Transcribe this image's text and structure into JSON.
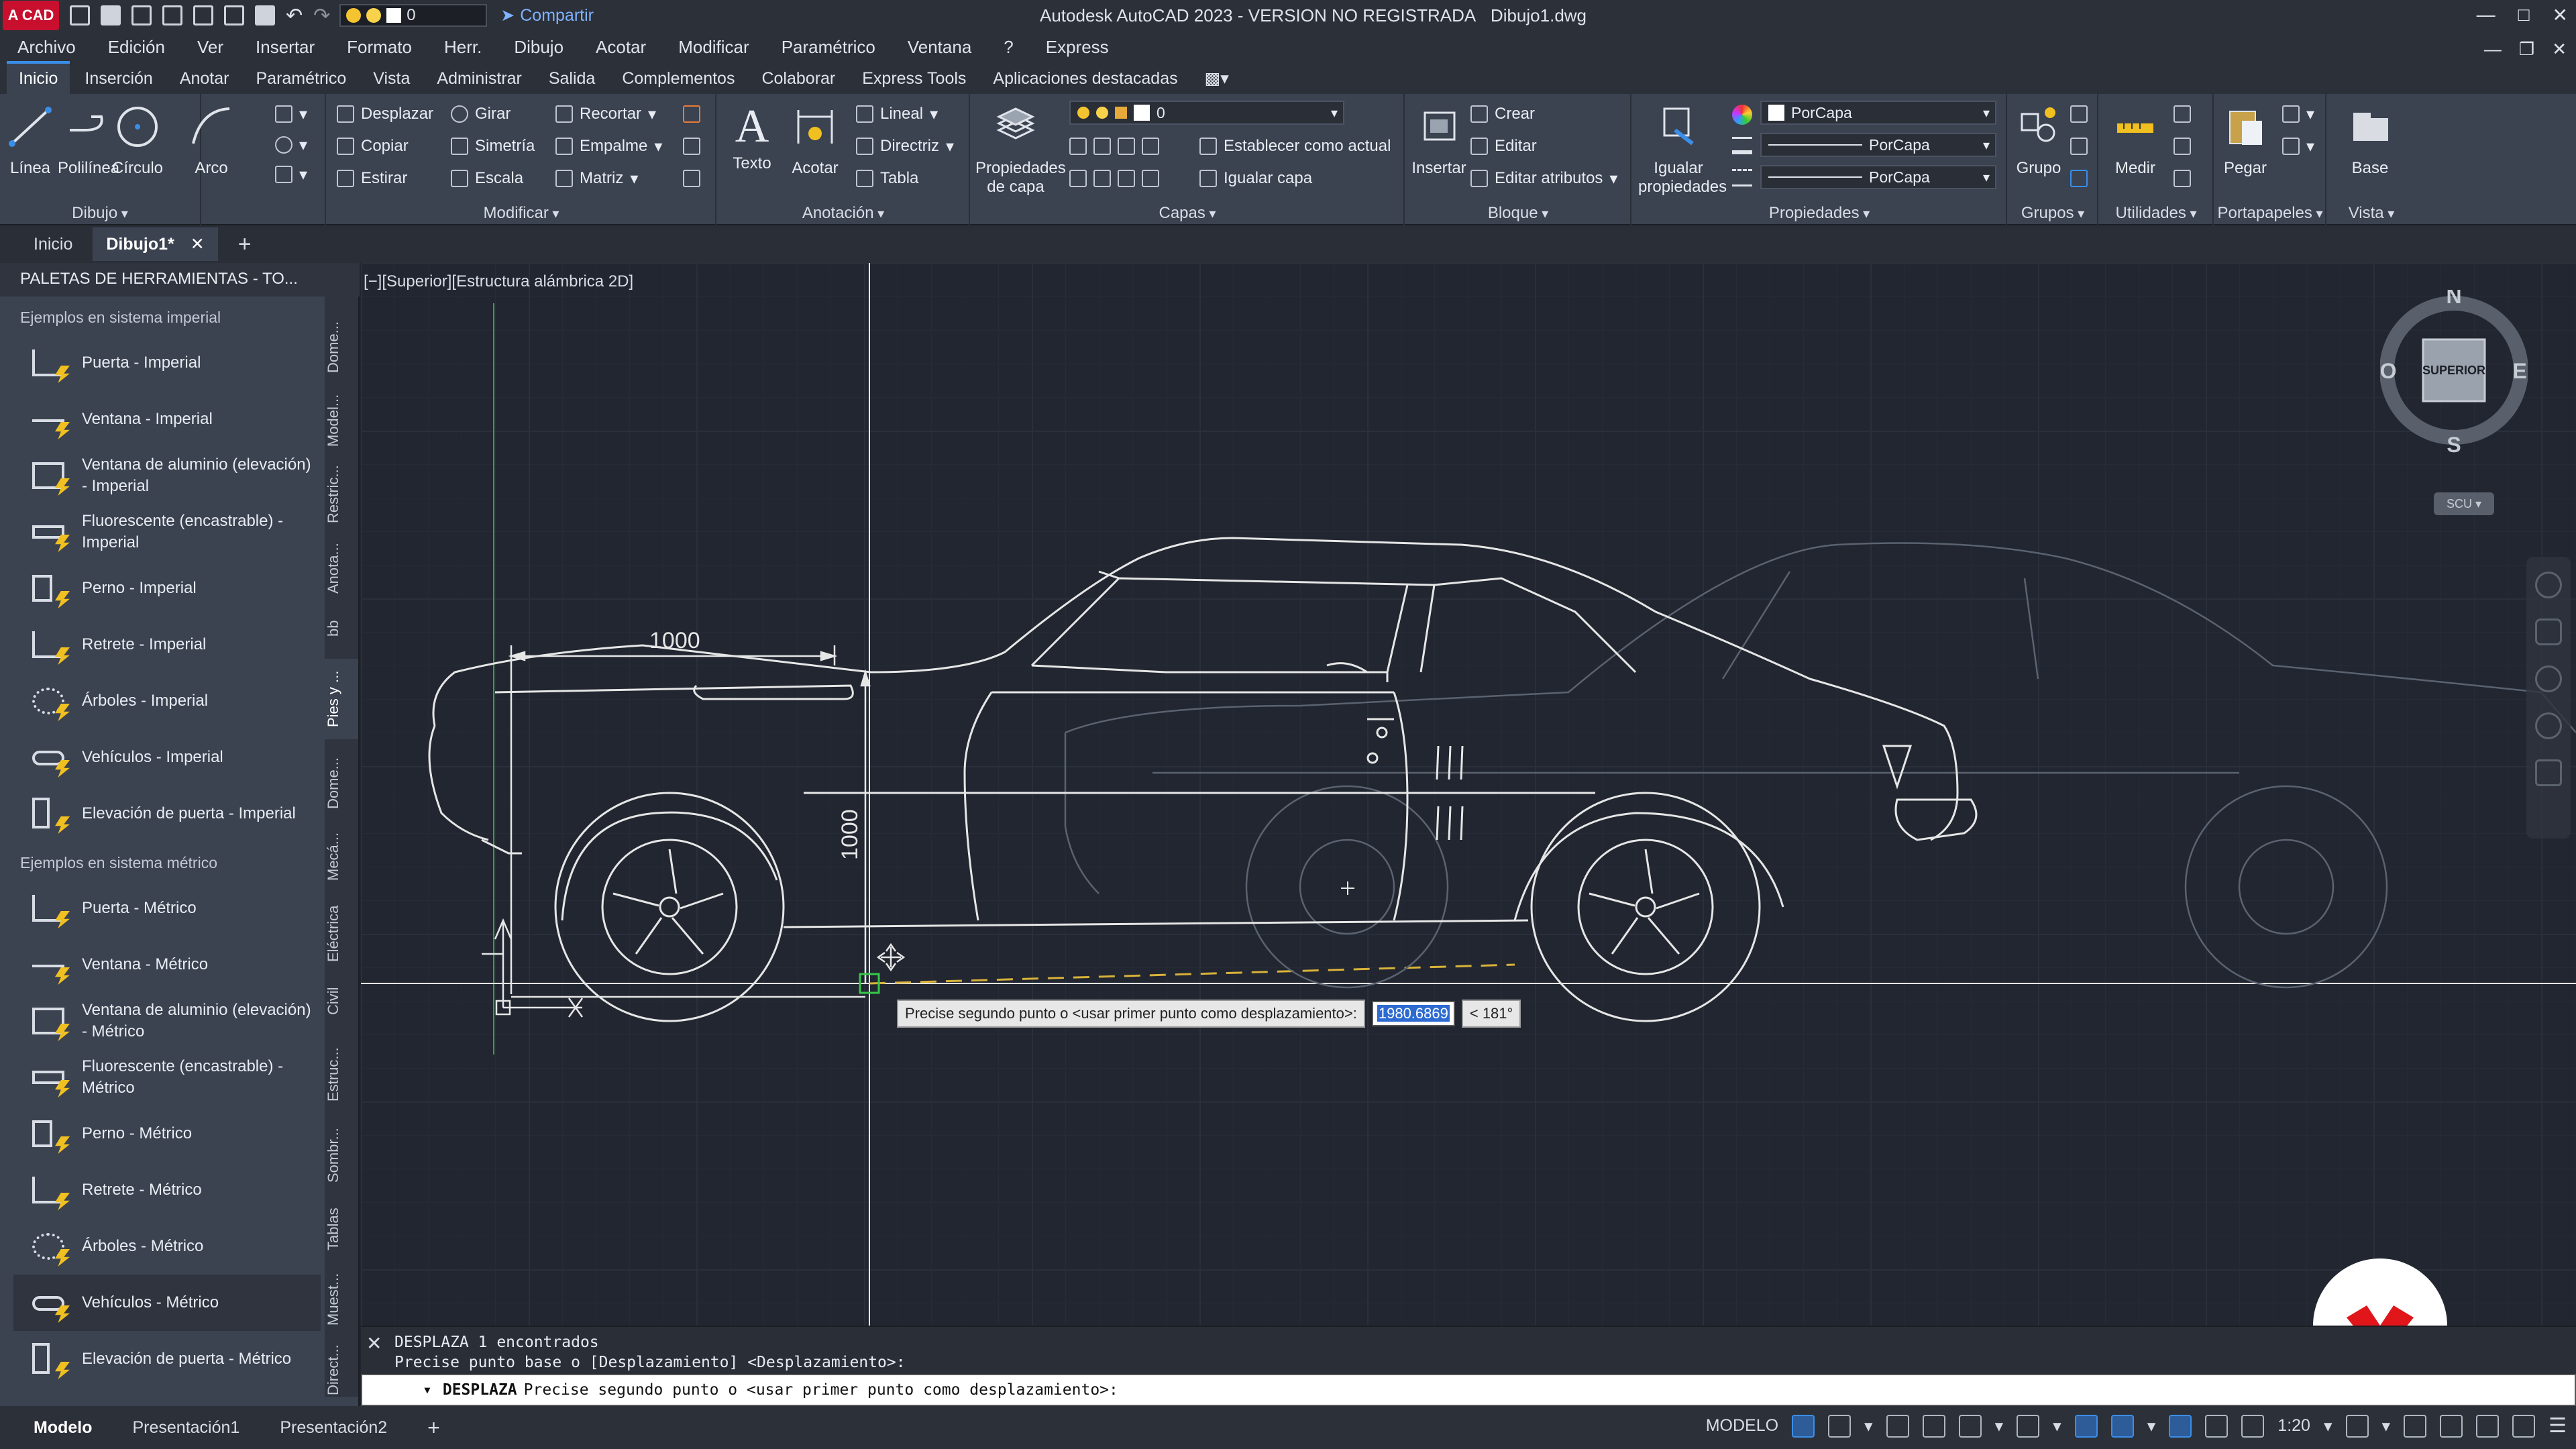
{
  "titlebar": {
    "app_logo": "A CAD",
    "layer_value": "0",
    "share_label": "Compartir",
    "title": "Autodesk AutoCAD 2023 - VERSION NO REGISTRADA",
    "filename": "Dibujo1.dwg"
  },
  "menu": [
    "Archivo",
    "Edición",
    "Ver",
    "Insertar",
    "Formato",
    "Herr.",
    "Dibujo",
    "Acotar",
    "Modificar",
    "Paramétrico",
    "Ventana",
    "?",
    "Express"
  ],
  "ribbon_tabs": [
    "Inicio",
    "Inserción",
    "Anotar",
    "Paramétrico",
    "Vista",
    "Administrar",
    "Salida",
    "Complementos",
    "Colaborar",
    "Express Tools",
    "Aplicaciones destacadas"
  ],
  "ribbon": {
    "dibujo": {
      "title": "Dibujo",
      "linea": "Línea",
      "polilinea": "Polilínea",
      "circulo": "Círculo",
      "arco": "Arco"
    },
    "modificar": {
      "title": "Modificar",
      "desplazar": "Desplazar",
      "girar": "Girar",
      "recortar": "Recortar",
      "copiar": "Copiar",
      "simetria": "Simetría",
      "empalme": "Empalme",
      "estirar": "Estirar",
      "escala": "Escala",
      "matriz": "Matriz"
    },
    "anotacion": {
      "title": "Anotación",
      "texto": "Texto",
      "acotar": "Acotar",
      "lineal": "Lineal",
      "directriz": "Directriz",
      "tabla": "Tabla"
    },
    "capas": {
      "title": "Capas",
      "propiedades": "Propiedades de capa",
      "layer": "0",
      "establecer": "Establecer como actual",
      "igualar": "Igualar capa"
    },
    "bloque": {
      "title": "Bloque",
      "insertar": "Insertar",
      "crear": "Crear",
      "editar": "Editar",
      "editar_atributos": "Editar atributos"
    },
    "propiedades": {
      "title": "Propiedades",
      "igualar": "Igualar propiedades",
      "color": "PorCapa",
      "linetype": "PorCapa",
      "lineweight": "PorCapa"
    },
    "grupos": {
      "title": "Grupos",
      "grupo": "Grupo"
    },
    "utilidades": {
      "title": "Utilidades",
      "medir": "Medir"
    },
    "portapapeles": {
      "title": "Portapapeles",
      "pegar": "Pegar"
    },
    "vista": {
      "title": "Vista",
      "base": "Base"
    }
  },
  "doc_tabs": {
    "inicio": "Inicio",
    "dibujo": "Dibujo1*"
  },
  "palette": {
    "header": "PALETAS DE HERRAMIENTAS - TO...",
    "group_imperial": "Ejemplos en sistema imperial",
    "imperial_items": [
      "Puerta - Imperial",
      "Ventana - Imperial",
      "Ventana de aluminio (elevación) - Imperial",
      "Fluorescente (encastrable) - Imperial",
      "Perno - Imperial",
      "Retrete - Imperial",
      "Árboles - Imperial",
      "Vehículos - Imperial",
      "Elevación de puerta - Imperial"
    ],
    "group_metric": "Ejemplos en sistema métrico",
    "metric_items": [
      "Puerta - Métrico",
      "Ventana - Métrico",
      "Ventana de aluminio (elevación) - Métrico",
      "Fluorescente (encastrable) - Métrico",
      "Perno - Métrico",
      "Retrete - Métrico",
      "Árboles - Métrico",
      "Vehículos - Métrico",
      "Elevación de puerta - Métrico"
    ],
    "side_tabs": [
      "Dome...",
      "Model...",
      "Restric...",
      "Anota...",
      "bb",
      "Pies y ...",
      "Dome...",
      "Mecá...",
      "Eléctrica",
      "Civil",
      "Estruc...",
      "Sombr...",
      "Tablas",
      "Muest...",
      "Direct..."
    ]
  },
  "viewport": {
    "label": "[−][Superior][Estructura alámbrica 2D]",
    "dim_horizontal": "1000",
    "dim_vertical": "1000",
    "viewcube": {
      "n": "N",
      "s": "S",
      "e": "E",
      "w": "O",
      "face": "SUPERIOR",
      "ucs": "SCU"
    }
  },
  "dynamic_input": {
    "prompt": "Precise segundo punto o <usar primer punto como desplazamiento>:",
    "value": "1980.6869",
    "angle": "< 181°"
  },
  "command": {
    "line1": "DESPLAZA 1 encontrados",
    "line2": "Precise punto base o [Desplazamiento] <Desplazamiento>:",
    "current_cmd": "DESPLAZA",
    "current_prompt": "Precise segundo punto o <usar primer punto como desplazamiento>:"
  },
  "status": {
    "tabs": [
      "Modelo",
      "Presentación1",
      "Presentación2"
    ],
    "model_label": "MODELO",
    "scale": "1:20"
  },
  "colors": {
    "accent": "#3b8ee8",
    "brand_red": "#c8102e",
    "badge_red": "#e0161b"
  }
}
